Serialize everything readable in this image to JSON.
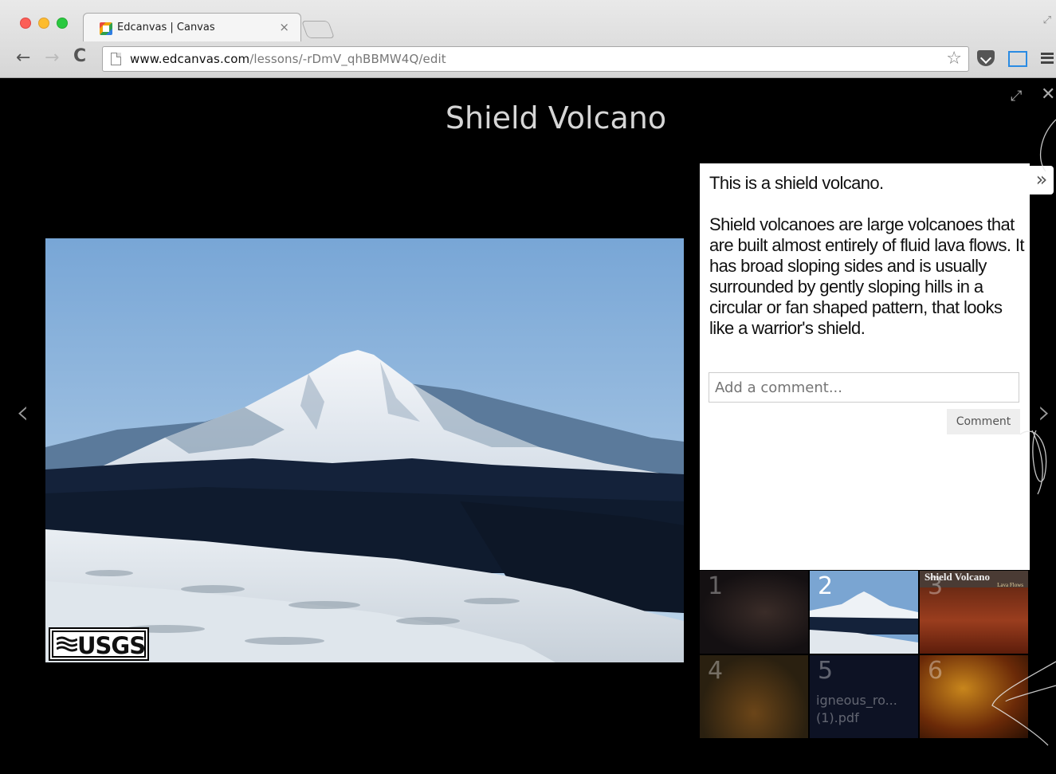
{
  "browser": {
    "tab_title": "Edcanvas | Canvas",
    "tab_close": "×",
    "url_host": "www.edcanvas.com",
    "url_path": "/lessons/-rDmV_qhBBMW4Q/edit"
  },
  "lesson": {
    "title": "Shield Volcano",
    "image_logo_text": "USGS",
    "notes": {
      "intro": "This is a shield volcano.",
      "body": "Shield volcanoes are large volcanoes that are built almost entirely of fluid lava flows. It has broad sloping sides and is usually surrounded by gently sloping hills in a circular or fan shaped pattern, that looks like a warrior's shield."
    },
    "comment": {
      "placeholder": "Add a comment...",
      "button_label": "Comment"
    },
    "thumbnails": [
      {
        "number": "1",
        "label": "",
        "active": false
      },
      {
        "number": "2",
        "label": "",
        "active": true
      },
      {
        "number": "3",
        "label": "",
        "active": false,
        "inner_title": "Shield Volcano",
        "inner_sub": "Lava Flows"
      },
      {
        "number": "4",
        "label": "",
        "active": false
      },
      {
        "number": "5",
        "label": "igneous_ro... (1).pdf",
        "active": false
      },
      {
        "number": "6",
        "label": "",
        "active": false
      }
    ]
  },
  "glyphs": {
    "back": "←",
    "forward": "→",
    "reload": "C",
    "star": "☆",
    "prev": "‹",
    "next": "›",
    "collapse": "»",
    "close": "✕",
    "expand": "⤢",
    "window_resize": "⤢"
  },
  "icons": {
    "star": "star-icon",
    "pocket": "pocket-icon",
    "menu": "menu-icon"
  },
  "colors": {
    "tl_red": "#fc5f57",
    "tl_yellow": "#fdbc2e",
    "tl_green": "#29c940",
    "page_background": "#000000",
    "panel_background": "#ffffff"
  }
}
